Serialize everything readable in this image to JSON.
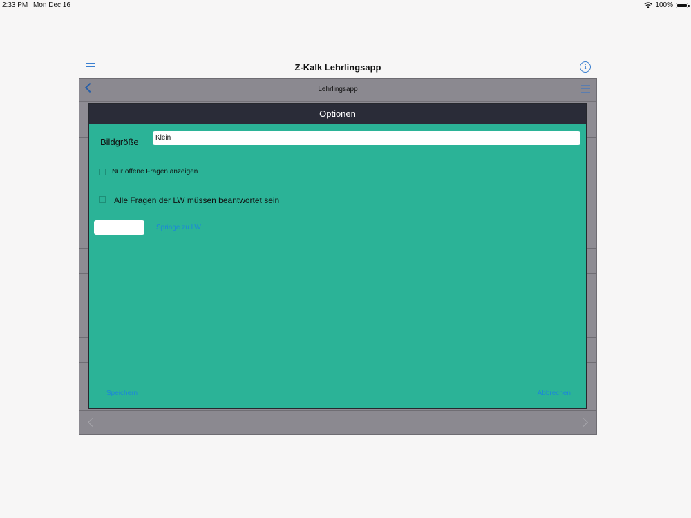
{
  "status_bar": {
    "time": "2:33 PM",
    "date": "Mon Dec 16",
    "battery": "100%",
    "icons": [
      "wifi-icon",
      "battery-icon"
    ]
  },
  "app": {
    "title": "Z-Kalk Lehrlingsapp",
    "icons": [
      "hamburger-icon",
      "info-icon"
    ],
    "info_glyph": "i",
    "accent_color": "#3a7fd0"
  },
  "background_view": {
    "title": "Lehrlingsapp",
    "icons": [
      "back-chevron-icon",
      "hamburger-icon",
      "prev-chevron-icon",
      "next-chevron-icon"
    ]
  },
  "modal": {
    "title": "Optionen",
    "header_color": "#2a2c38",
    "background_color": "#2bb397",
    "image_size": {
      "label": "Bildgröße",
      "value": "Klein"
    },
    "only_open_questions": {
      "label": "Nur offene Fragen anzeigen",
      "checked": false
    },
    "all_questions_answered": {
      "label": "Alle Fragen der LW müssen beantwortet sein",
      "checked": false
    },
    "jump": {
      "input_value": "",
      "link_label": "Springe zu LW"
    },
    "save_label": "Speichern",
    "cancel_label": "Abbrechen",
    "link_color": "#1d86d9"
  }
}
